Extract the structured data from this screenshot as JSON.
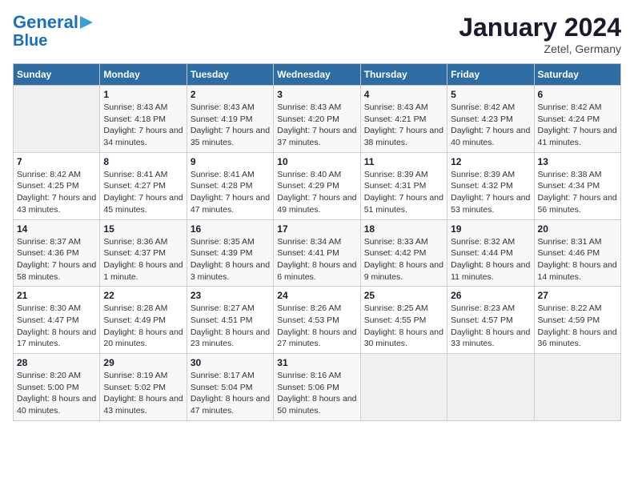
{
  "logo": {
    "line1": "General",
    "line2": "Blue"
  },
  "title": "January 2024",
  "subtitle": "Zetel, Germany",
  "days_of_week": [
    "Sunday",
    "Monday",
    "Tuesday",
    "Wednesday",
    "Thursday",
    "Friday",
    "Saturday"
  ],
  "weeks": [
    [
      {
        "day": "",
        "sunrise": "",
        "sunset": "",
        "daylight": ""
      },
      {
        "day": "1",
        "sunrise": "Sunrise: 8:43 AM",
        "sunset": "Sunset: 4:18 PM",
        "daylight": "Daylight: 7 hours and 34 minutes."
      },
      {
        "day": "2",
        "sunrise": "Sunrise: 8:43 AM",
        "sunset": "Sunset: 4:19 PM",
        "daylight": "Daylight: 7 hours and 35 minutes."
      },
      {
        "day": "3",
        "sunrise": "Sunrise: 8:43 AM",
        "sunset": "Sunset: 4:20 PM",
        "daylight": "Daylight: 7 hours and 37 minutes."
      },
      {
        "day": "4",
        "sunrise": "Sunrise: 8:43 AM",
        "sunset": "Sunset: 4:21 PM",
        "daylight": "Daylight: 7 hours and 38 minutes."
      },
      {
        "day": "5",
        "sunrise": "Sunrise: 8:42 AM",
        "sunset": "Sunset: 4:23 PM",
        "daylight": "Daylight: 7 hours and 40 minutes."
      },
      {
        "day": "6",
        "sunrise": "Sunrise: 8:42 AM",
        "sunset": "Sunset: 4:24 PM",
        "daylight": "Daylight: 7 hours and 41 minutes."
      }
    ],
    [
      {
        "day": "7",
        "sunrise": "Sunrise: 8:42 AM",
        "sunset": "Sunset: 4:25 PM",
        "daylight": "Daylight: 7 hours and 43 minutes."
      },
      {
        "day": "8",
        "sunrise": "Sunrise: 8:41 AM",
        "sunset": "Sunset: 4:27 PM",
        "daylight": "Daylight: 7 hours and 45 minutes."
      },
      {
        "day": "9",
        "sunrise": "Sunrise: 8:41 AM",
        "sunset": "Sunset: 4:28 PM",
        "daylight": "Daylight: 7 hours and 47 minutes."
      },
      {
        "day": "10",
        "sunrise": "Sunrise: 8:40 AM",
        "sunset": "Sunset: 4:29 PM",
        "daylight": "Daylight: 7 hours and 49 minutes."
      },
      {
        "day": "11",
        "sunrise": "Sunrise: 8:39 AM",
        "sunset": "Sunset: 4:31 PM",
        "daylight": "Daylight: 7 hours and 51 minutes."
      },
      {
        "day": "12",
        "sunrise": "Sunrise: 8:39 AM",
        "sunset": "Sunset: 4:32 PM",
        "daylight": "Daylight: 7 hours and 53 minutes."
      },
      {
        "day": "13",
        "sunrise": "Sunrise: 8:38 AM",
        "sunset": "Sunset: 4:34 PM",
        "daylight": "Daylight: 7 hours and 56 minutes."
      }
    ],
    [
      {
        "day": "14",
        "sunrise": "Sunrise: 8:37 AM",
        "sunset": "Sunset: 4:36 PM",
        "daylight": "Daylight: 7 hours and 58 minutes."
      },
      {
        "day": "15",
        "sunrise": "Sunrise: 8:36 AM",
        "sunset": "Sunset: 4:37 PM",
        "daylight": "Daylight: 8 hours and 1 minute."
      },
      {
        "day": "16",
        "sunrise": "Sunrise: 8:35 AM",
        "sunset": "Sunset: 4:39 PM",
        "daylight": "Daylight: 8 hours and 3 minutes."
      },
      {
        "day": "17",
        "sunrise": "Sunrise: 8:34 AM",
        "sunset": "Sunset: 4:41 PM",
        "daylight": "Daylight: 8 hours and 6 minutes."
      },
      {
        "day": "18",
        "sunrise": "Sunrise: 8:33 AM",
        "sunset": "Sunset: 4:42 PM",
        "daylight": "Daylight: 8 hours and 9 minutes."
      },
      {
        "day": "19",
        "sunrise": "Sunrise: 8:32 AM",
        "sunset": "Sunset: 4:44 PM",
        "daylight": "Daylight: 8 hours and 11 minutes."
      },
      {
        "day": "20",
        "sunrise": "Sunrise: 8:31 AM",
        "sunset": "Sunset: 4:46 PM",
        "daylight": "Daylight: 8 hours and 14 minutes."
      }
    ],
    [
      {
        "day": "21",
        "sunrise": "Sunrise: 8:30 AM",
        "sunset": "Sunset: 4:47 PM",
        "daylight": "Daylight: 8 hours and 17 minutes."
      },
      {
        "day": "22",
        "sunrise": "Sunrise: 8:28 AM",
        "sunset": "Sunset: 4:49 PM",
        "daylight": "Daylight: 8 hours and 20 minutes."
      },
      {
        "day": "23",
        "sunrise": "Sunrise: 8:27 AM",
        "sunset": "Sunset: 4:51 PM",
        "daylight": "Daylight: 8 hours and 23 minutes."
      },
      {
        "day": "24",
        "sunrise": "Sunrise: 8:26 AM",
        "sunset": "Sunset: 4:53 PM",
        "daylight": "Daylight: 8 hours and 27 minutes."
      },
      {
        "day": "25",
        "sunrise": "Sunrise: 8:25 AM",
        "sunset": "Sunset: 4:55 PM",
        "daylight": "Daylight: 8 hours and 30 minutes."
      },
      {
        "day": "26",
        "sunrise": "Sunrise: 8:23 AM",
        "sunset": "Sunset: 4:57 PM",
        "daylight": "Daylight: 8 hours and 33 minutes."
      },
      {
        "day": "27",
        "sunrise": "Sunrise: 8:22 AM",
        "sunset": "Sunset: 4:59 PM",
        "daylight": "Daylight: 8 hours and 36 minutes."
      }
    ],
    [
      {
        "day": "28",
        "sunrise": "Sunrise: 8:20 AM",
        "sunset": "Sunset: 5:00 PM",
        "daylight": "Daylight: 8 hours and 40 minutes."
      },
      {
        "day": "29",
        "sunrise": "Sunrise: 8:19 AM",
        "sunset": "Sunset: 5:02 PM",
        "daylight": "Daylight: 8 hours and 43 minutes."
      },
      {
        "day": "30",
        "sunrise": "Sunrise: 8:17 AM",
        "sunset": "Sunset: 5:04 PM",
        "daylight": "Daylight: 8 hours and 47 minutes."
      },
      {
        "day": "31",
        "sunrise": "Sunrise: 8:16 AM",
        "sunset": "Sunset: 5:06 PM",
        "daylight": "Daylight: 8 hours and 50 minutes."
      },
      {
        "day": "",
        "sunrise": "",
        "sunset": "",
        "daylight": ""
      },
      {
        "day": "",
        "sunrise": "",
        "sunset": "",
        "daylight": ""
      },
      {
        "day": "",
        "sunrise": "",
        "sunset": "",
        "daylight": ""
      }
    ]
  ]
}
